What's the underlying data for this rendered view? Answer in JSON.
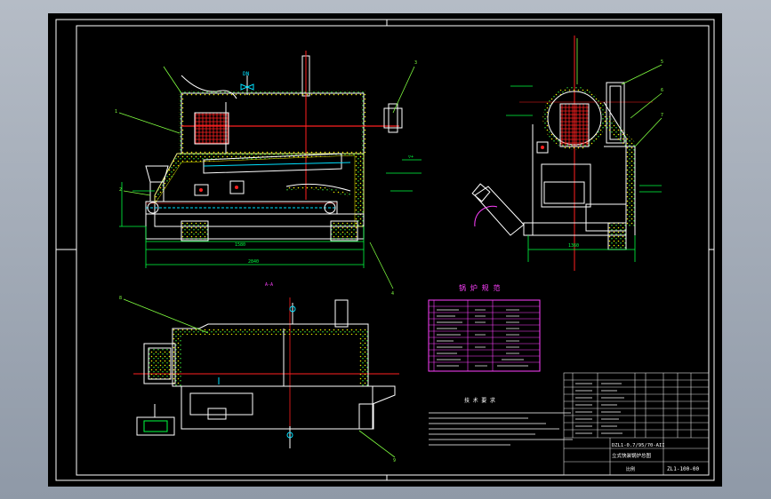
{
  "drawing": {
    "section_mark": "A-A",
    "spec_table_title": "锅 炉 规 范",
    "tech_req_title": "技 术 要 求",
    "title_block": {
      "model": "DZL1-0.7/95/70-AII",
      "name": "立式快装锅炉总图",
      "drawing_no": "ZL1-100-00",
      "scale_label": "比例"
    }
  },
  "colors": {
    "background": "#000000",
    "frame": "#ffffff",
    "outline": "#ffffff",
    "pipe_red": "#ff2020",
    "dimension_green": "#00ff40",
    "insulation_yellow": "#e8e800",
    "label_cyan": "#00e0ff",
    "leader_green": "#80ff40",
    "table_magenta": "#ff40ff",
    "table_lines": "#e0e0e0",
    "section_blue": "#3050ff"
  }
}
